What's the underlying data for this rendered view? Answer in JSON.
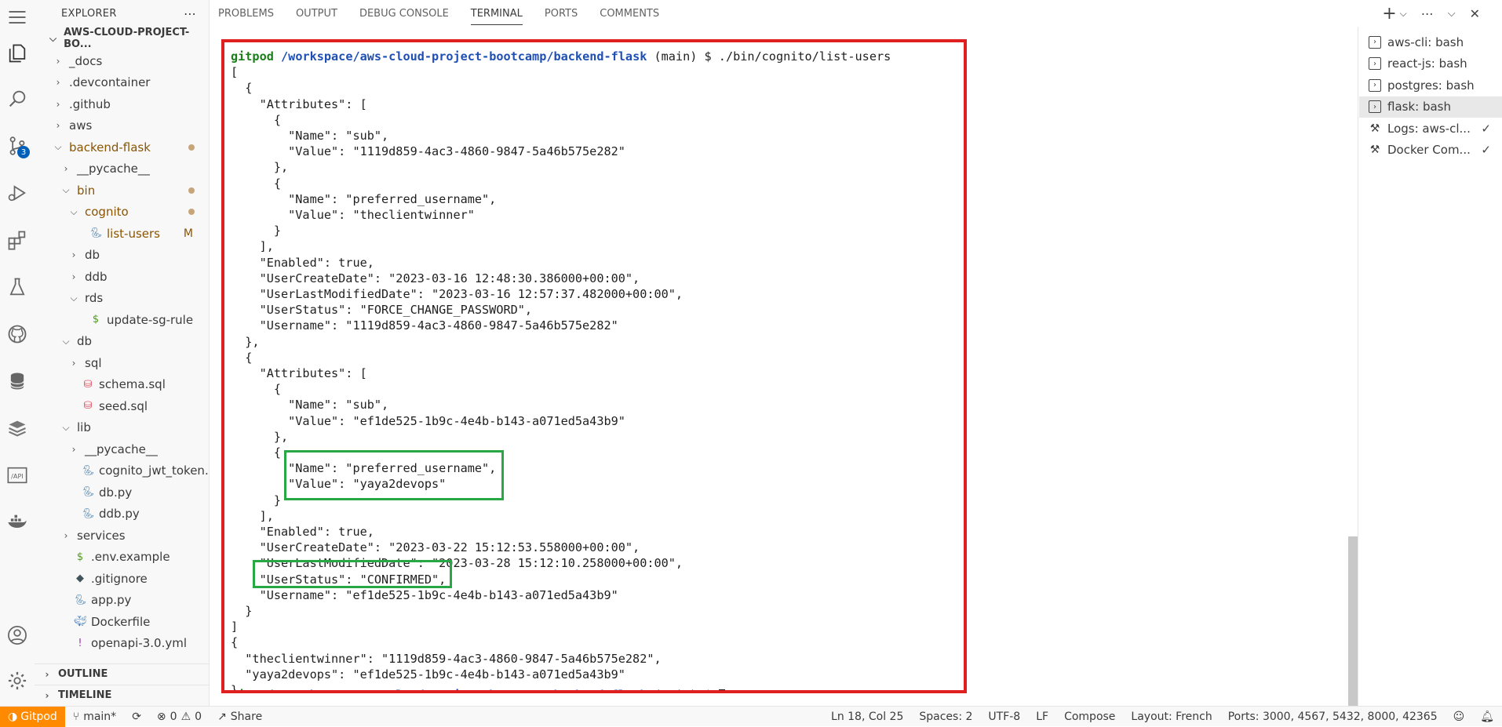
{
  "sidebar": {
    "title": "EXPLORER",
    "project": "AWS-CLOUD-PROJECT-BO...",
    "items": [
      {
        "label": "_docs",
        "type": "folder",
        "depth": 1,
        "open": false
      },
      {
        "label": ".devcontainer",
        "type": "folder",
        "depth": 1,
        "open": false
      },
      {
        "label": ".github",
        "type": "folder",
        "depth": 1,
        "open": false
      },
      {
        "label": "aws",
        "type": "folder",
        "depth": 1,
        "open": false
      },
      {
        "label": "backend-flask",
        "type": "folder",
        "depth": 1,
        "open": true
      },
      {
        "label": "__pycache__",
        "type": "folder",
        "depth": 2,
        "open": false
      },
      {
        "label": "bin",
        "type": "folder",
        "depth": 2,
        "open": true
      },
      {
        "label": "cognito",
        "type": "folder",
        "depth": 3,
        "open": true
      },
      {
        "label": "list-users",
        "type": "python",
        "depth": 4
      },
      {
        "label": "db",
        "type": "folder",
        "depth": 3,
        "open": false
      },
      {
        "label": "ddb",
        "type": "folder",
        "depth": 3,
        "open": false
      },
      {
        "label": "rds",
        "type": "folder",
        "depth": 3,
        "open": true
      },
      {
        "label": "update-sg-rule",
        "type": "shell",
        "depth": 4
      },
      {
        "label": "db",
        "type": "folder",
        "depth": 2,
        "open": true
      },
      {
        "label": "sql",
        "type": "folder",
        "depth": 3,
        "open": false
      },
      {
        "label": "schema.sql",
        "type": "sql",
        "depth": 3
      },
      {
        "label": "seed.sql",
        "type": "sql",
        "depth": 3
      },
      {
        "label": "lib",
        "type": "folder",
        "depth": 2,
        "open": true
      },
      {
        "label": "__pycache__",
        "type": "folder",
        "depth": 3,
        "open": false
      },
      {
        "label": "cognito_jwt_token....",
        "type": "python",
        "depth": 3
      },
      {
        "label": "db.py",
        "type": "python",
        "depth": 3
      },
      {
        "label": "ddb.py",
        "type": "python",
        "depth": 3
      },
      {
        "label": "services",
        "type": "folder",
        "depth": 2,
        "open": false
      },
      {
        "label": ".env.example",
        "type": "shell",
        "depth": 2
      },
      {
        "label": ".gitignore",
        "type": "git",
        "depth": 2
      },
      {
        "label": "app.py",
        "type": "python",
        "depth": 2
      },
      {
        "label": "Dockerfile",
        "type": "docker",
        "depth": 2
      },
      {
        "label": "openapi-3.0.yml",
        "type": "yaml",
        "depth": 2
      }
    ],
    "modified_marker": "M",
    "outline": "OUTLINE",
    "timeline": "TIMELINE"
  },
  "activity": {
    "scm_badge": "3"
  },
  "panel": {
    "tabs": [
      "PROBLEMS",
      "OUTPUT",
      "DEBUG CONSOLE",
      "TERMINAL",
      "PORTS",
      "COMMENTS"
    ],
    "active_tab": "TERMINAL"
  },
  "terminal": {
    "prompt_user": "gitpod",
    "prompt_path": "/workspace/aws-cloud-project-bootcamp/backend-flask",
    "prompt_suffix": " (main) $ ",
    "command": "./bin/cognito/list-users",
    "output": [
      "[",
      "  {",
      "    \"Attributes\": [",
      "      {",
      "        \"Name\": \"sub\",",
      "        \"Value\": \"1119d859-4ac3-4860-9847-5a46b575e282\"",
      "      },",
      "      {",
      "        \"Name\": \"preferred_username\",",
      "        \"Value\": \"theclientwinner\"",
      "      }",
      "    ],",
      "    \"Enabled\": true,",
      "    \"UserCreateDate\": \"2023-03-16 12:48:30.386000+00:00\",",
      "    \"UserLastModifiedDate\": \"2023-03-16 12:57:37.482000+00:00\",",
      "    \"UserStatus\": \"FORCE_CHANGE_PASSWORD\",",
      "    \"Username\": \"1119d859-4ac3-4860-9847-5a46b575e282\"",
      "  },",
      "  {",
      "    \"Attributes\": [",
      "      {",
      "        \"Name\": \"sub\",",
      "        \"Value\": \"ef1de525-1b9c-4e4b-b143-a071ed5a43b9\"",
      "      },",
      "      {",
      "        \"Name\": \"preferred_username\",",
      "        \"Value\": \"yaya2devops\"",
      "      }",
      "    ],",
      "    \"Enabled\": true,",
      "    \"UserCreateDate\": \"2023-03-22 15:12:53.558000+00:00\",",
      "    \"UserLastModifiedDate\": \"2023-03-28 15:12:10.258000+00:00\",",
      "    \"UserStatus\": \"CONFIRMED\",",
      "    \"Username\": \"ef1de525-1b9c-4e4b-b143-a071ed5a43b9\"",
      "  }",
      "]",
      "{",
      "  \"theclientwinner\": \"1119d859-4ac3-4860-9847-5a46b575e282\",",
      "  \"yaya2devops\": \"ef1de525-1b9c-4e4b-b143-a071ed5a43b9\"",
      "}"
    ]
  },
  "terminal_list": [
    {
      "label": "aws-cli: bash",
      "icon": "terminal-icon",
      "active": false,
      "check": false
    },
    {
      "label": "react-js: bash",
      "icon": "terminal-icon",
      "active": false,
      "check": false
    },
    {
      "label": "postgres: bash",
      "icon": "terminal-icon",
      "active": false,
      "check": false
    },
    {
      "label": "flask: bash",
      "icon": "terminal-icon",
      "active": true,
      "check": false
    },
    {
      "label": "Logs: aws-cl...",
      "icon": "tools-icon",
      "active": false,
      "check": true
    },
    {
      "label": "Docker Com...",
      "icon": "tools-icon",
      "active": false,
      "check": true
    }
  ],
  "status_bar": {
    "remote": "Gitpod",
    "branch": "main*",
    "errors": "0",
    "warnings": "0",
    "share": "Share",
    "position": "Ln 18, Col 25",
    "spaces": "Spaces: 2",
    "encoding": "UTF-8",
    "eol": "LF",
    "language": "Compose",
    "layout": "Layout: French",
    "ports": "Ports: 3000, 4567, 5432, 8000, 42365"
  },
  "colors": {
    "highlight_red": "#e02020",
    "highlight_green": "#28a745",
    "remote_orange": "#ff8a00",
    "badge_blue": "#005fb8"
  }
}
